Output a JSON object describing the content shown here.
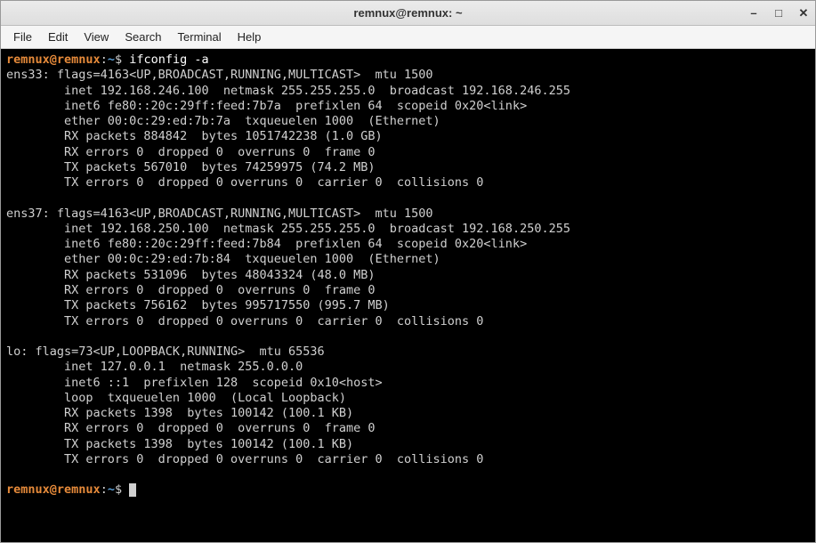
{
  "window": {
    "title": "remnux@remnux: ~"
  },
  "menubar": {
    "file": "File",
    "edit": "Edit",
    "view": "View",
    "search": "Search",
    "terminal": "Terminal",
    "help": "Help"
  },
  "prompt": {
    "user": "remnux",
    "at": "@",
    "host": "remnux",
    "colon": ":",
    "path": "~",
    "dollar": "$ "
  },
  "command": "ifconfig -a",
  "output": {
    "l01": "ens33: flags=4163<UP,BROADCAST,RUNNING,MULTICAST>  mtu 1500",
    "l02": "        inet 192.168.246.100  netmask 255.255.255.0  broadcast 192.168.246.255",
    "l03": "        inet6 fe80::20c:29ff:feed:7b7a  prefixlen 64  scopeid 0x20<link>",
    "l04": "        ether 00:0c:29:ed:7b:7a  txqueuelen 1000  (Ethernet)",
    "l05": "        RX packets 884842  bytes 1051742238 (1.0 GB)",
    "l06": "        RX errors 0  dropped 0  overruns 0  frame 0",
    "l07": "        TX packets 567010  bytes 74259975 (74.2 MB)",
    "l08": "        TX errors 0  dropped 0 overruns 0  carrier 0  collisions 0",
    "l09": "",
    "l10": "ens37: flags=4163<UP,BROADCAST,RUNNING,MULTICAST>  mtu 1500",
    "l11": "        inet 192.168.250.100  netmask 255.255.255.0  broadcast 192.168.250.255",
    "l12": "        inet6 fe80::20c:29ff:feed:7b84  prefixlen 64  scopeid 0x20<link>",
    "l13": "        ether 00:0c:29:ed:7b:84  txqueuelen 1000  (Ethernet)",
    "l14": "        RX packets 531096  bytes 48043324 (48.0 MB)",
    "l15": "        RX errors 0  dropped 0  overruns 0  frame 0",
    "l16": "        TX packets 756162  bytes 995717550 (995.7 MB)",
    "l17": "        TX errors 0  dropped 0 overruns 0  carrier 0  collisions 0",
    "l18": "",
    "l19": "lo: flags=73<UP,LOOPBACK,RUNNING>  mtu 65536",
    "l20": "        inet 127.0.0.1  netmask 255.0.0.0",
    "l21": "        inet6 ::1  prefixlen 128  scopeid 0x10<host>",
    "l22": "        loop  txqueuelen 1000  (Local Loopback)",
    "l23": "        RX packets 1398  bytes 100142 (100.1 KB)",
    "l24": "        RX errors 0  dropped 0  overruns 0  frame 0",
    "l25": "        TX packets 1398  bytes 100142 (100.1 KB)",
    "l26": "        TX errors 0  dropped 0 overruns 0  carrier 0  collisions 0",
    "l27": ""
  }
}
